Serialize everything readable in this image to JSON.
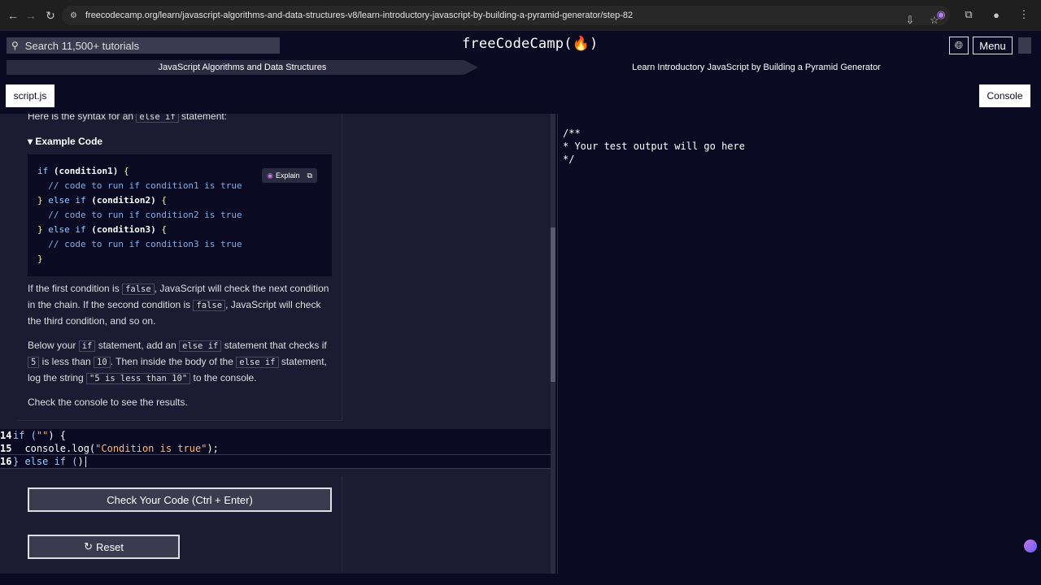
{
  "browser": {
    "url": "freecodecamp.org/learn/javascript-algorithms-and-data-structures-v8/learn-introductory-javascript-by-building-a-pyramid-generator/step-82"
  },
  "nav": {
    "search_placeholder": "Search 11,500+ tutorials",
    "logo": "freeCodeCamp(🔥)",
    "menu_label": "Menu"
  },
  "breadcrumbs": {
    "superblock": "JavaScript Algorithms and Data Structures",
    "block": "Learn Introductory JavaScript by Building a Pyramid Generator"
  },
  "tabs": {
    "file": "script.js",
    "console": "Console"
  },
  "lesson": {
    "intro_pre": "Here is the syntax for an ",
    "intro_code": "else if",
    "intro_post": " statement:",
    "example_label": "Example Code",
    "explain_label": "Explain",
    "p1_a": "If the first condition is ",
    "p1_code1": "false",
    "p1_b": ", JavaScript will check the next condition in the chain. If the second condition is ",
    "p1_code2": "false",
    "p1_c": ", JavaScript will check the third condition, and so on.",
    "p2_a": "Below your ",
    "p2_code1": "if",
    "p2_b": " statement, add an ",
    "p2_code2": "else if",
    "p2_c": " statement that checks if ",
    "p2_code3": "5",
    "p2_d": " is less than ",
    "p2_code4": "10",
    "p2_e": ". Then inside the body of the ",
    "p2_code5": "else if",
    "p2_f": " statement, log the string ",
    "p2_code6": "\"5 is less than 10\"",
    "p2_g": " to the console.",
    "p3": "Check the console to see the results."
  },
  "example_code": {
    "l1_kw": "if",
    "l1_cond": "(condition1)",
    "c1": "// code to run if condition1 is true",
    "l3_kw": "else if",
    "l3_cond": "(condition2)",
    "c2": "// code to run if condition2 is true",
    "l5_kw": "else if",
    "l5_cond": "(condition3)",
    "c3": "// code to run if condition3 is true",
    "open": "{",
    "close": "}"
  },
  "editor": {
    "lines": [
      {
        "num": "14",
        "text_a": "if (",
        "str": "\"\"",
        "text_b": ") {"
      },
      {
        "num": "15",
        "text_a": "  console.log(",
        "str": "\"Condition is true\"",
        "text_b": ");"
      },
      {
        "num": "16",
        "text_a": "} else if (",
        "str": "",
        "text_b": ")"
      }
    ]
  },
  "actions": {
    "check_label": "Check Your Code (Ctrl + Enter)",
    "reset_label": "Reset"
  },
  "console": {
    "output": "/**\n* Your test output will go here\n*/"
  }
}
